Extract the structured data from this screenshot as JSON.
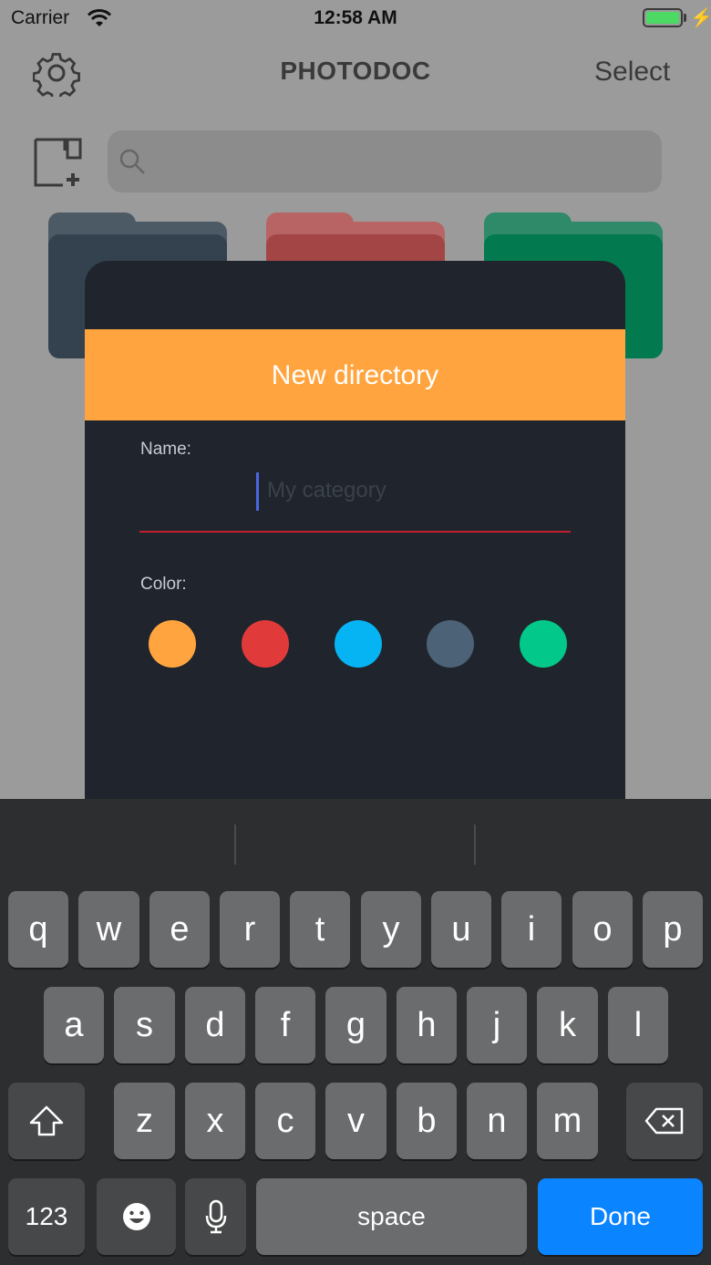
{
  "status_bar": {
    "carrier": "Carrier",
    "time": "12:58 AM",
    "icons": [
      "wifi-icon",
      "battery-icon",
      "charging-bolt-icon"
    ]
  },
  "nav": {
    "title": "PHOTODOC",
    "select_label": "Select",
    "icons": [
      "gear-icon",
      "new-folder-icon",
      "search-icon"
    ]
  },
  "folders": [
    {
      "color": "#34424f"
    },
    {
      "color": "#a34545"
    },
    {
      "color": "#02794f"
    }
  ],
  "dialog": {
    "title": "New directory",
    "name_label": "Name:",
    "name_placeholder": "My category",
    "name_value": "",
    "color_label": "Color:",
    "colors": [
      "#ffa43e",
      "#e03a3a",
      "#06b3f3",
      "#4b6277",
      "#02c98a"
    ],
    "header_color": "#ffa43e"
  },
  "keyboard": {
    "row1": [
      "q",
      "w",
      "e",
      "r",
      "t",
      "y",
      "u",
      "i",
      "o",
      "p"
    ],
    "row2": [
      "a",
      "s",
      "d",
      "f",
      "g",
      "h",
      "j",
      "k",
      "l"
    ],
    "row3": [
      "z",
      "x",
      "c",
      "v",
      "b",
      "n",
      "m"
    ],
    "numbers_label": "123",
    "space_label": "space",
    "done_label": "Done",
    "icons": [
      "shift-icon",
      "backspace-icon",
      "emoji-icon",
      "microphone-icon"
    ]
  }
}
